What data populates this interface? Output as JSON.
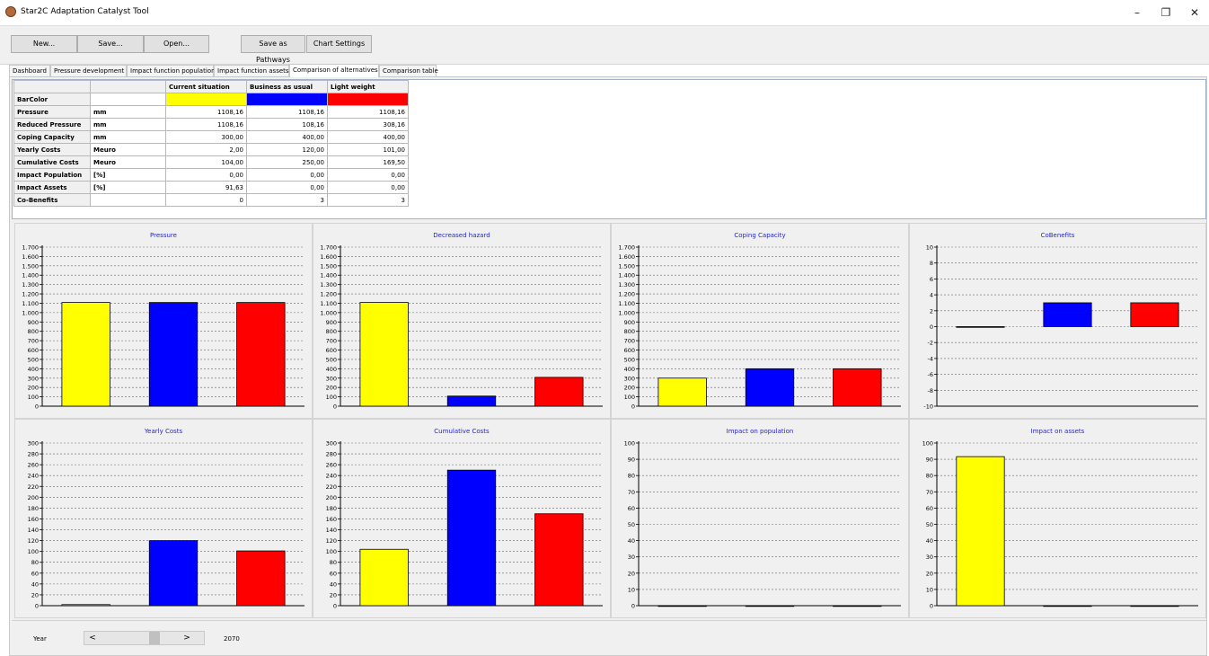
{
  "window": {
    "title": "Star2C Adaptation Catalyst Tool",
    "minimize": "–",
    "restore": "❐",
    "close": "✕"
  },
  "toolbar": {
    "new": "New...",
    "save": "Save...",
    "open": "Open...",
    "save_pathways": "Save as Pathways",
    "chart_settings": "Chart Settings"
  },
  "tabs": [
    "Dashboard",
    "Pressure development",
    "Impact function population",
    "Impact function assets",
    "Comparison of alternatives",
    "Comparison table"
  ],
  "active_tab": "Comparison of alternatives",
  "table": {
    "columns": [
      "Current situation",
      "Business as usual",
      "Light weight"
    ],
    "barcolor_label": "BarColor",
    "bar_colors": [
      "#ffff00",
      "#0000ff",
      "#ff0000"
    ],
    "rows": [
      {
        "label": "Pressure",
        "unit": "mm",
        "values": [
          "1108,16",
          "1108,16",
          "1108,16"
        ]
      },
      {
        "label": "Reduced Pressure",
        "unit": "mm",
        "values": [
          "1108,16",
          "108,16",
          "308,16"
        ]
      },
      {
        "label": "Coping Capacity",
        "unit": "mm",
        "values": [
          "300,00",
          "400,00",
          "400,00"
        ]
      },
      {
        "label": "Yearly Costs",
        "unit": "Meuro",
        "values": [
          "2,00",
          "120,00",
          "101,00"
        ]
      },
      {
        "label": "Cumulative Costs",
        "unit": "Meuro",
        "values": [
          "104,00",
          "250,00",
          "169,50"
        ]
      },
      {
        "label": "Impact Population",
        "unit": "[%]",
        "values": [
          "0,00",
          "0,00",
          "0,00"
        ]
      },
      {
        "label": "Impact Assets",
        "unit": "[%]",
        "values": [
          "91,63",
          "0,00",
          "0,00"
        ]
      },
      {
        "label": "Co-Benefits",
        "unit": "",
        "values": [
          "0",
          "3",
          "3"
        ]
      }
    ]
  },
  "chart_data": [
    {
      "type": "bar",
      "title": "Pressure",
      "categories": [
        "Current situation",
        "Business as usual",
        "Light weight"
      ],
      "values": [
        1108.16,
        1108.16,
        1108.16
      ],
      "ylim": [
        0,
        1700
      ],
      "ystep": 100,
      "thousands_sep": true,
      "grid": true
    },
    {
      "type": "bar",
      "title": "Decreased hazard",
      "categories": [
        "Current situation",
        "Business as usual",
        "Light weight"
      ],
      "values": [
        1108.16,
        108.16,
        308.16
      ],
      "ylim": [
        0,
        1700
      ],
      "ystep": 100,
      "thousands_sep": true,
      "grid": true
    },
    {
      "type": "bar",
      "title": "Coping Capacity",
      "categories": [
        "Current situation",
        "Business as usual",
        "Light weight"
      ],
      "values": [
        300,
        400,
        400
      ],
      "ylim": [
        0,
        1700
      ],
      "ystep": 100,
      "thousands_sep": true,
      "grid": true
    },
    {
      "type": "bar",
      "title": "CoBenefits",
      "categories": [
        "Current situation",
        "Business as usual",
        "Light weight"
      ],
      "values": [
        0,
        3,
        3
      ],
      "ylim": [
        -10,
        10
      ],
      "ystep": 2,
      "thousands_sep": false,
      "grid": true
    },
    {
      "type": "bar",
      "title": "Yearly Costs",
      "categories": [
        "Current situation",
        "Business as usual",
        "Light weight"
      ],
      "values": [
        2,
        120,
        101
      ],
      "ylim": [
        0,
        300
      ],
      "ystep": 20,
      "thousands_sep": false,
      "grid": true
    },
    {
      "type": "bar",
      "title": "Cumulative Costs",
      "categories": [
        "Current situation",
        "Business as usual",
        "Light weight"
      ],
      "values": [
        104,
        250,
        169.5
      ],
      "ylim": [
        0,
        300
      ],
      "ystep": 20,
      "thousands_sep": false,
      "grid": true
    },
    {
      "type": "bar",
      "title": "Impact on population",
      "categories": [
        "Current situation",
        "Business as usual",
        "Light weight"
      ],
      "values": [
        0,
        0,
        0
      ],
      "ylim": [
        0,
        100
      ],
      "ystep": 10,
      "thousands_sep": false,
      "grid": true
    },
    {
      "type": "bar",
      "title": "Impact on assets",
      "categories": [
        "Current situation",
        "Business as usual",
        "Light weight"
      ],
      "values": [
        91.63,
        0,
        0
      ],
      "ylim": [
        0,
        100
      ],
      "ystep": 10,
      "thousands_sep": false,
      "grid": true
    }
  ],
  "chart_colors": {
    "title": "#1f1fcc",
    "grid": "#666666",
    "bar_outline": "#000000"
  },
  "year": {
    "label": "Year",
    "value": "2070",
    "left_arrow": "<",
    "right_arrow": ">"
  }
}
